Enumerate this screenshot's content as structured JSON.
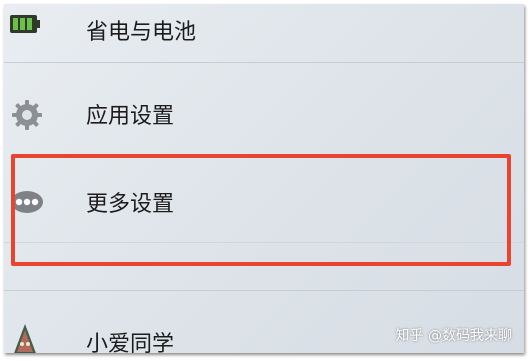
{
  "settings": {
    "items": [
      {
        "label": "省电与电池",
        "icon": "battery-icon"
      },
      {
        "label": "应用设置",
        "icon": "gear-icon"
      },
      {
        "label": "更多设置",
        "icon": "more-dots-icon"
      },
      {
        "label": "小爱同学",
        "icon": "xiaoai-icon"
      }
    ]
  },
  "watermark": {
    "text": "知乎 @数码我来聊"
  },
  "colors": {
    "highlight": "#e8442f",
    "battery": "#54a83a",
    "background": "#e2e7ec"
  }
}
